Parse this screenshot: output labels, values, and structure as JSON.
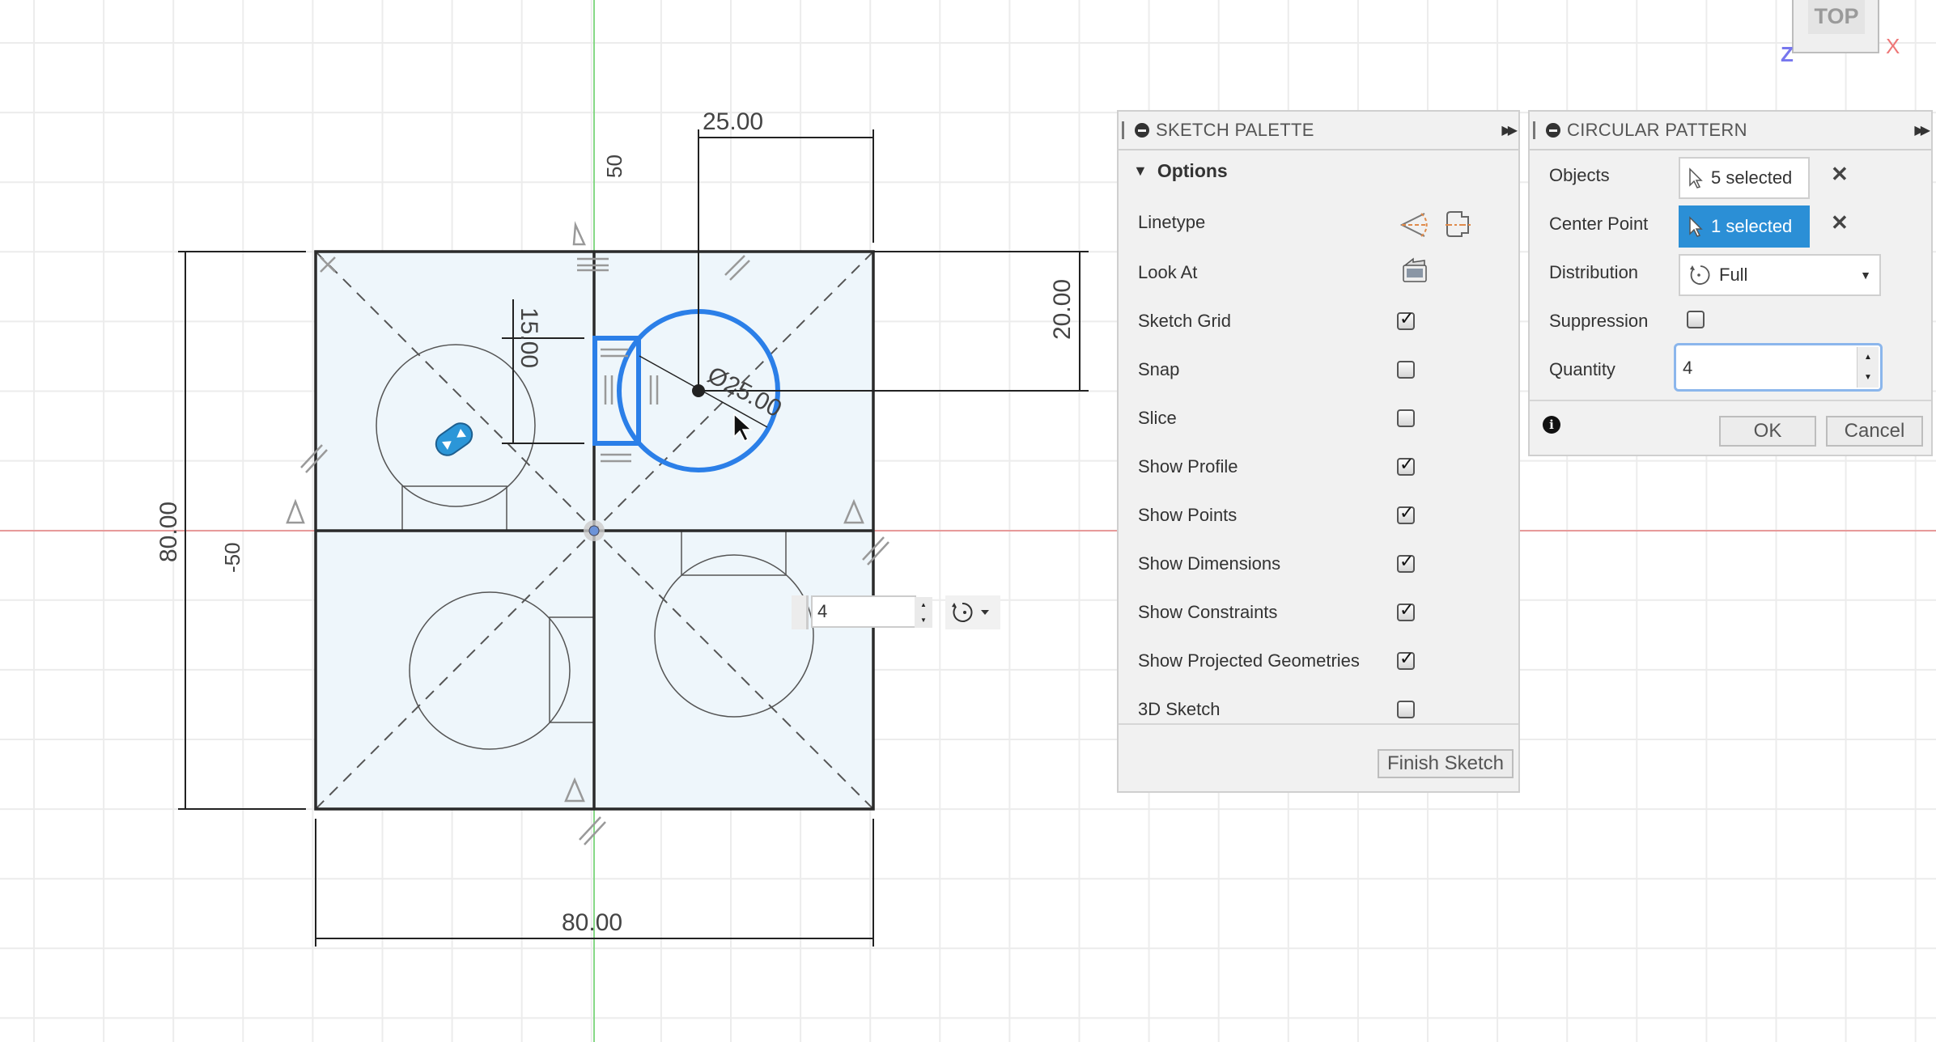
{
  "viewcube": {
    "face_label": "TOP",
    "axis_x": "X",
    "axis_z": "Z"
  },
  "canvas": {
    "axis_labels": {
      "y_axis_value": "50",
      "x_axis_value": "-50"
    },
    "dimensions": {
      "top_width": "25.00",
      "right_height": "20.00",
      "left_height": "80.00",
      "bottom_width": "80.00",
      "inner_vertical": "15.00",
      "diameter": "Ø25.00"
    },
    "inline_quantity": {
      "value": "4"
    },
    "colors": {
      "selection": "#2b7fe8",
      "profile_fill": "#eef6fb",
      "x_axis": "#e88a8a",
      "y_axis": "#7ed47e"
    }
  },
  "sketch_palette": {
    "title": "SKETCH PALETTE",
    "section": "Options",
    "linetype_label": "Linetype",
    "look_at_label": "Look At",
    "options": [
      {
        "label": "Sketch Grid",
        "checked": true
      },
      {
        "label": "Snap",
        "checked": false
      },
      {
        "label": "Slice",
        "checked": false
      },
      {
        "label": "Show Profile",
        "checked": true
      },
      {
        "label": "Show Points",
        "checked": true
      },
      {
        "label": "Show Dimensions",
        "checked": true
      },
      {
        "label": "Show Constraints",
        "checked": true
      },
      {
        "label": "Show Projected Geometries",
        "checked": true
      },
      {
        "label": "3D Sketch",
        "checked": false
      }
    ],
    "finish_button": "Finish Sketch"
  },
  "circular_pattern": {
    "title": "CIRCULAR PATTERN",
    "objects_label": "Objects",
    "objects_value": "5 selected",
    "center_label": "Center Point",
    "center_value": "1 selected",
    "distribution_label": "Distribution",
    "distribution_value": "Full",
    "suppression_label": "Suppression",
    "suppression_checked": false,
    "quantity_label": "Quantity",
    "quantity_value": "4",
    "ok_button": "OK",
    "cancel_button": "Cancel",
    "accent_color": "#2b8fd6"
  }
}
